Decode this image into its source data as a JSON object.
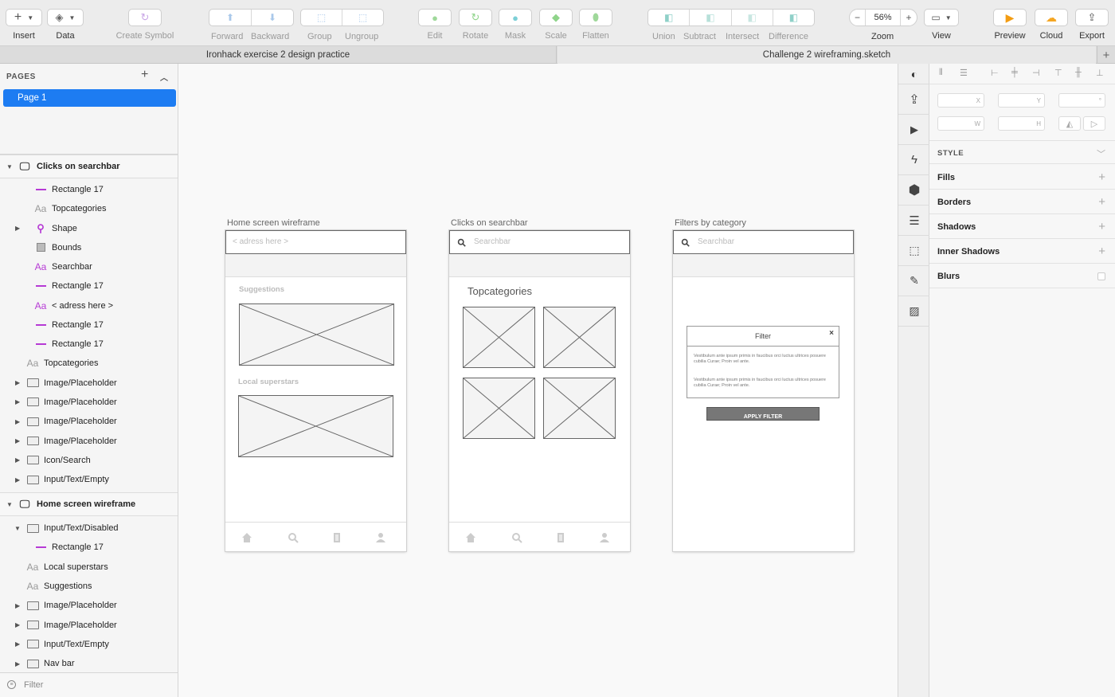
{
  "toolbar": {
    "insert": "Insert",
    "data": "Data",
    "create_symbol": "Create Symbol",
    "forward": "Forward",
    "backward": "Backward",
    "group": "Group",
    "ungroup": "Ungroup",
    "edit": "Edit",
    "rotate": "Rotate",
    "mask": "Mask",
    "scale": "Scale",
    "flatten": "Flatten",
    "union": "Union",
    "subtract": "Subtract",
    "intersect": "Intersect",
    "difference": "Difference",
    "zoom_value": "56%",
    "zoom_minus": "−",
    "zoom_plus": "+",
    "zoom": "Zoom",
    "view": "View",
    "preview": "Preview",
    "cloud": "Cloud",
    "export": "Export"
  },
  "tabs": {
    "left": "Ironhack exercise 2 design practice",
    "right": "Challenge 2 wireframing.sketch",
    "add": "+"
  },
  "pages": {
    "heading": "PAGES",
    "add": "+",
    "collapse": "^",
    "items": [
      "Page 1"
    ]
  },
  "layers": {
    "group1": {
      "name": "Clicks on searchbar",
      "items": [
        "Rectangle 17",
        "Topcategories",
        "Shape",
        "Bounds",
        "Searchbar",
        "Rectangle 17",
        "< adress here >",
        "Rectangle 17",
        "Rectangle 17",
        "Topcategories",
        "Image/Placeholder",
        "Image/Placeholder",
        "Image/Placeholder",
        "Image/Placeholder",
        "Icon/Search",
        "Input/Text/Empty"
      ]
    },
    "group2": {
      "name": "Home screen wireframe",
      "items": [
        "Input/Text/Disabled",
        "Rectangle 17",
        "Local superstars",
        "Suggestions",
        "Image/Placeholder",
        "Image/Placeholder",
        "Input/Text/Empty",
        "Nav bar"
      ]
    },
    "filter_placeholder": "Filter"
  },
  "artboards": [
    {
      "label": "Home screen wireframe",
      "search_text": "< adress here >",
      "section1": "Suggestions",
      "section2": "Local superstars"
    },
    {
      "label": "Clicks on searchbar",
      "search_text": "Searchbar",
      "heading": "Topcategories"
    },
    {
      "label": "Filters by category",
      "search_text": "Searchbar",
      "modal_title": "Filter",
      "modal_close": "×",
      "modal_text1": "Vestibulum ante ipsum primis in faucibus orci luctus  ultrices posuere cubilia Curae; Proin vel ante.",
      "modal_text2": "Vestibulum ante ipsum primis in faucibus orci luctus  ultrices posuere cubilia Curae; Proin vel ante.",
      "button": "APPLY FILTER"
    }
  ],
  "inspector": {
    "x": "X",
    "y": "Y",
    "rotation": "°",
    "w": "W",
    "h": "H",
    "style": "STYLE",
    "fills": "Fills",
    "borders": "Borders",
    "shadows": "Shadows",
    "inner_shadows": "Inner Shadows",
    "blurs": "Blurs"
  },
  "colors": {
    "selection": "#1d7cf2",
    "shape_layer": "#b63ad5",
    "toolbar_bg": "#ececec"
  }
}
